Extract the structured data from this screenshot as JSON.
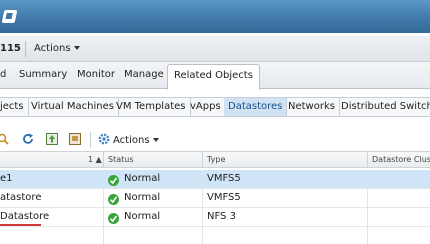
{
  "object_bar": {
    "name": "115",
    "actions_label": "Actions"
  },
  "tabs": [
    {
      "label": "d"
    },
    {
      "label": "Summary"
    },
    {
      "label": "Monitor"
    },
    {
      "label": "Manage"
    },
    {
      "label": "Related Objects",
      "active": true
    }
  ],
  "subtabs": [
    {
      "label": "jects"
    },
    {
      "label": "Virtual Machines"
    },
    {
      "label": "VM Templates"
    },
    {
      "label": "vApps"
    },
    {
      "label": "Datastores",
      "active": true
    },
    {
      "label": "Networks"
    },
    {
      "label": "Distributed Switche"
    }
  ],
  "toolbar": {
    "actions_label": "Actions"
  },
  "grid": {
    "columns": {
      "name_sort": "1 ▲",
      "status": "Status",
      "type": "Type",
      "cluster": "Datastore Clust"
    },
    "rows": [
      {
        "name": "e1",
        "status": "Normal",
        "type": "VMFS5",
        "selected": true
      },
      {
        "name": "atastore",
        "status": "Normal",
        "type": "VMFS5",
        "selected": false
      },
      {
        "name": "Datastore",
        "status": "Normal",
        "type": "NFS 3",
        "selected": false
      }
    ]
  },
  "colors": {
    "header_blue": "#3f78a8",
    "selected_row": "#cfe4f6",
    "status_ok": "#3aa33a",
    "underline_red": "#d23a3a"
  }
}
